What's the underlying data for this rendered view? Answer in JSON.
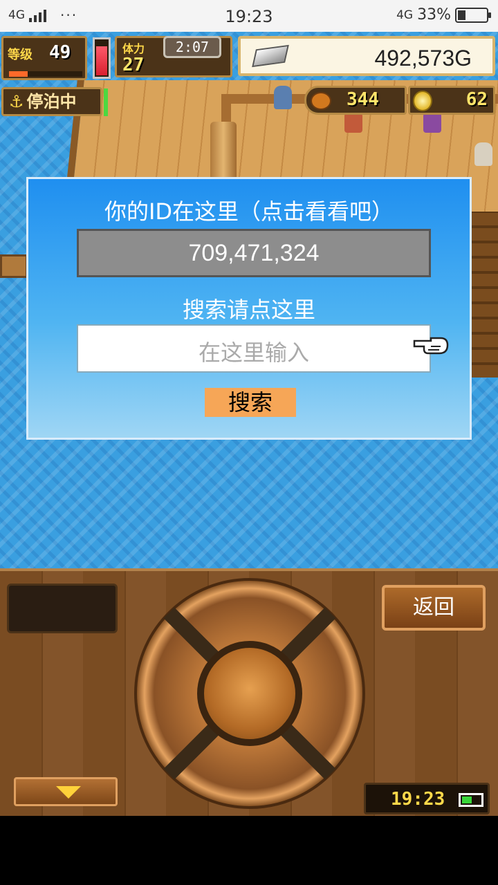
{
  "status_bar": {
    "network": "4G",
    "dots": "···",
    "time": "19:23",
    "net_right": "4G",
    "battery": "33%",
    "battery_level": 0.33
  },
  "hud": {
    "level_label": "等级",
    "level": "49",
    "level_progress": 0.25,
    "hp_level": 0.85,
    "stamina_label": "体力",
    "stamina": "27",
    "timer": "2:07",
    "gold": "492,573G",
    "anchor_mark": "⚓",
    "anchor_status": "停泊中",
    "resource1": "344",
    "resource2": "62"
  },
  "dialog": {
    "title": "你的ID在这里（点击看看吧）",
    "id_value": "709,471,324",
    "search_title": "搜索请点这里",
    "input_placeholder": "在这里输入",
    "search_button": "搜索"
  },
  "controller": {
    "back_button": "返回",
    "clock": "19:23",
    "battery_level": 0.6
  },
  "colors": {
    "dialog_top": "#1f8ff0",
    "search_button": "#f6a657",
    "id_box": "#8d8d8d",
    "sea": "#3a9fe0"
  }
}
